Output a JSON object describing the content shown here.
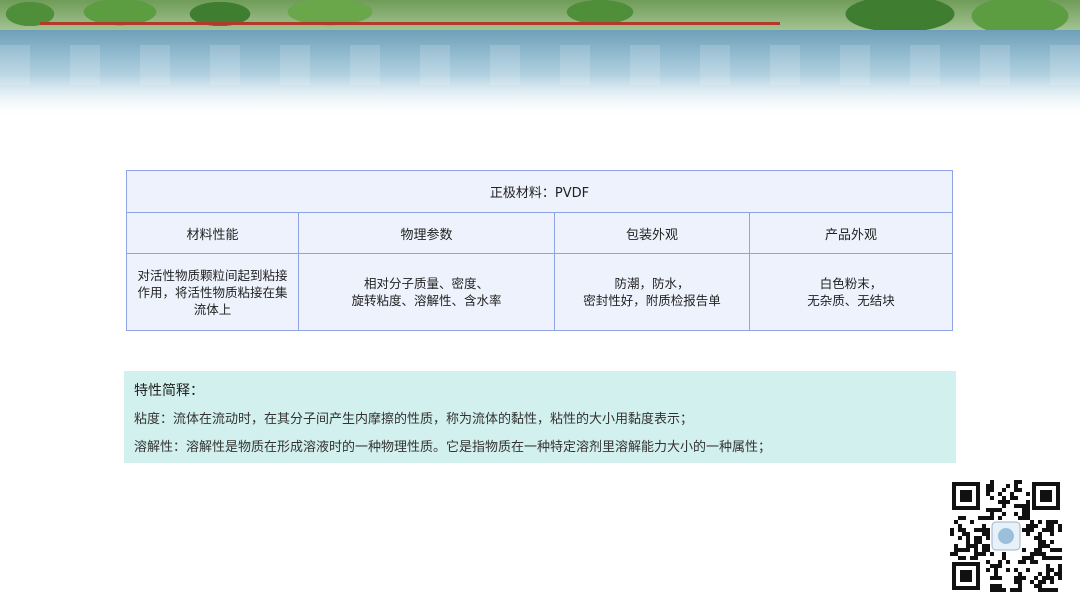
{
  "table": {
    "title": "正极材料：PVDF",
    "headers": [
      "材料性能",
      "物理参数",
      "包装外观",
      "产品外观"
    ],
    "cells": [
      [
        "对活性物质颗粒间起到粘接",
        "作用，将活性物质粘接在集",
        "流体上"
      ],
      [
        "相对分子质量、密度、",
        "旋转粘度、溶解性、含水率"
      ],
      [
        "防潮，防水，",
        "密封性好，附质检报告单"
      ],
      [
        "白色粉末，",
        "无杂质、无结块"
      ]
    ]
  },
  "notes": {
    "heading": "特性简释：",
    "lines": [
      "粘度：流体在流动时，在其分子间产生内摩擦的性质，称为流体的黏性，粘性的大小用黏度表示；",
      "溶解性：溶解性是物质在形成溶液时的一种物理性质。它是指物质在一种特定溶剂里溶解能力大小的一种属性；"
    ]
  },
  "decor": {
    "banner": "river-landscape-banner",
    "qr": "qr-code-icon"
  }
}
